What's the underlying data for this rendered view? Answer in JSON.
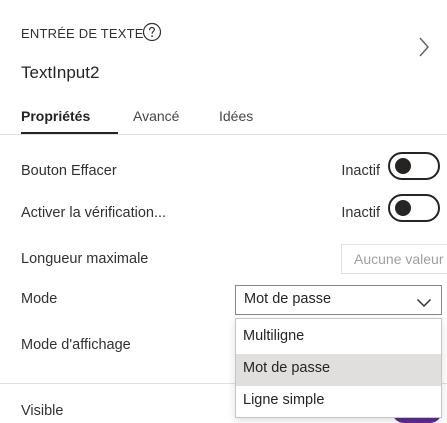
{
  "header": {
    "type_label": "ENTRÉE DE TEXTE",
    "control_name": "TextInput2"
  },
  "tabs": [
    {
      "label": "Propriétés",
      "active": true
    },
    {
      "label": "Avancé",
      "active": false
    },
    {
      "label": "Idées",
      "active": false
    }
  ],
  "properties": {
    "clear_button": {
      "label": "Bouton Effacer",
      "value": "Inactif",
      "on": false
    },
    "spellcheck": {
      "label": "Activer la vérification...",
      "value": "Inactif",
      "on": false
    },
    "max_length": {
      "label": "Longueur maximale",
      "placeholder": "Aucune valeur"
    },
    "mode": {
      "label": "Mode",
      "selected": "Mot de passe"
    },
    "display_mode": {
      "label": "Mode d'affichage"
    },
    "visible": {
      "label": "Visible",
      "on": true
    }
  },
  "mode_options": [
    "Multiligne",
    "Mot de passe",
    "Ligne simple"
  ],
  "colors": {
    "accent": "#5c2d91",
    "selected_option_bg": "#e1dfdd",
    "text": "#252423"
  },
  "icons": {
    "help": "help-circle-icon",
    "expand": "chevron-right-icon",
    "dropdown": "chevron-down-icon"
  }
}
